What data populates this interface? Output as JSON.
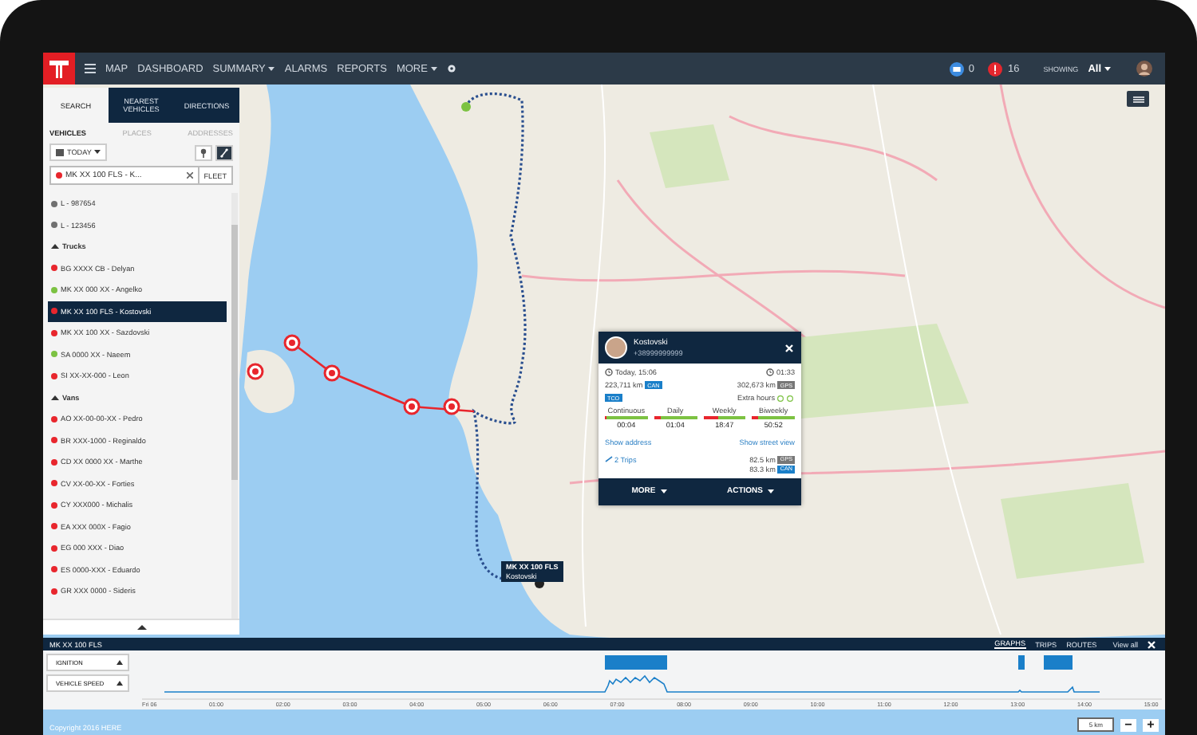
{
  "nav": {
    "items": [
      {
        "label": "MAP",
        "dropdown": false
      },
      {
        "label": "DASHBOARD",
        "dropdown": false
      },
      {
        "label": "SUMMARY",
        "dropdown": true
      },
      {
        "label": "ALARMS",
        "dropdown": false
      },
      {
        "label": "REPORTS",
        "dropdown": false
      },
      {
        "label": "MORE",
        "dropdown": true
      }
    ],
    "messages": "0",
    "alerts": "16",
    "showing_label": "SHOWING",
    "showing_value": "All"
  },
  "sidebar": {
    "tabs": [
      {
        "label": "SEARCH",
        "selected": true
      },
      {
        "label": "NEAREST VEHICLES",
        "selected": false
      },
      {
        "label": "DIRECTIONS",
        "selected": false
      }
    ],
    "subtabs": [
      {
        "label": "VEHICLES",
        "selected": true
      },
      {
        "label": "PLACES",
        "selected": false
      },
      {
        "label": "ADDRESSES",
        "selected": false
      }
    ],
    "date": "TODAY",
    "search": {
      "value": "MK XX 100 FLS - K..."
    },
    "fleet_button": "FLEET",
    "vehicles": [
      {
        "kind": "vehicle",
        "label": "L - 987654",
        "color": "#707070",
        "selected": false
      },
      {
        "kind": "vehicle",
        "label": "L - 123456",
        "color": "#707070",
        "selected": false
      },
      {
        "kind": "group",
        "label": "Trucks",
        "expanded": true
      },
      {
        "kind": "vehicle",
        "label": "BG XXXX CB - Delyan",
        "color": "#e8262d",
        "selected": false
      },
      {
        "kind": "vehicle",
        "label": "MK XX 000 XX - Angelko",
        "color": "#7cc242",
        "selected": false
      },
      {
        "kind": "vehicle",
        "label": "MK XX 100 FLS - Kostovski",
        "color": "#e8262d",
        "selected": true
      },
      {
        "kind": "vehicle",
        "label": "MK XX 100 XX - Sazdovski",
        "color": "#e8262d",
        "selected": false
      },
      {
        "kind": "vehicle",
        "label": "SA 0000 XX - Naeem",
        "color": "#7cc242",
        "selected": false
      },
      {
        "kind": "vehicle",
        "label": "SI XX-XX-000 - Leon",
        "color": "#e8262d",
        "selected": false
      },
      {
        "kind": "group",
        "label": "Vans",
        "expanded": true
      },
      {
        "kind": "vehicle",
        "label": "AO XX-00-00-XX - Pedro",
        "color": "#e8262d",
        "selected": false
      },
      {
        "kind": "vehicle",
        "label": "BR XXX-1000 - Reginaldo",
        "color": "#e8262d",
        "selected": false
      },
      {
        "kind": "vehicle",
        "label": "CD XX 0000 XX - Marthe",
        "color": "#e8262d",
        "selected": false
      },
      {
        "kind": "vehicle",
        "label": "CV XX-00-XX - Forties",
        "color": "#e8262d",
        "selected": false
      },
      {
        "kind": "vehicle",
        "label": "CY XXX000 - Michalis",
        "color": "#e8262d",
        "selected": false
      },
      {
        "kind": "vehicle",
        "label": "EA XXX 000X - Fagio",
        "color": "#e8262d",
        "selected": false
      },
      {
        "kind": "vehicle",
        "label": "EG 000 XXX - Diao",
        "color": "#e8262d",
        "selected": false
      },
      {
        "kind": "vehicle",
        "label": "ES 0000-XXX - Eduardo",
        "color": "#e8262d",
        "selected": false
      },
      {
        "kind": "vehicle",
        "label": "GR XXX 0000 - Sideris",
        "color": "#e8262d",
        "selected": false
      }
    ]
  },
  "vehicle_label": {
    "plate": "MK XX 100 FLS",
    "driver": "Kostovski"
  },
  "popup": {
    "name": "Kostovski",
    "phone": "+38999999999",
    "time": "Today, 15:06",
    "duration": "01:33",
    "odometers": [
      {
        "value": "223,711 km",
        "badge": "CAN"
      },
      {
        "value": "302,673 km",
        "badge": "GPS"
      }
    ],
    "tco": "TCO",
    "extra_hours": "Extra hours",
    "periods": [
      {
        "label": "Continuous",
        "value": "00:04",
        "level": 0.03
      },
      {
        "label": "Daily",
        "value": "01:04",
        "level": 0.15
      },
      {
        "label": "Weekly",
        "value": "18:47",
        "level": 0.35
      },
      {
        "label": "Biweekly",
        "value": "50:52",
        "level": 0.15
      }
    ],
    "show_address": "Show address",
    "show_street_view": "Show street view",
    "trips": "2 Trips",
    "distances": [
      {
        "value": "82.5 km",
        "badge": "GPS"
      },
      {
        "value": "83.3 km",
        "badge": "CAN"
      }
    ],
    "buttons": [
      "MORE",
      "ACTIONS"
    ]
  },
  "timeline": {
    "title": "MK XX 100 FLS",
    "tabs": [
      {
        "label": "GRAPHS",
        "selected": true
      },
      {
        "label": "TRIPS",
        "selected": false
      },
      {
        "label": "ROUTES",
        "selected": false
      }
    ],
    "view_all": "View all",
    "rows": [
      "IGNITION",
      "VEHICLE SPEED"
    ],
    "ticks": [
      "Fri 06",
      "01:00",
      "02:00",
      "03:00",
      "04:00",
      "05:00",
      "06:00",
      "07:00",
      "08:00",
      "09:00",
      "10:00",
      "11:00",
      "12:00",
      "13:00",
      "14:00",
      "15:00"
    ]
  },
  "footer": {
    "copyright": "Copyright 2016 HERE",
    "scale": "5 km",
    "zoom_out": "−",
    "zoom_in": "+"
  }
}
